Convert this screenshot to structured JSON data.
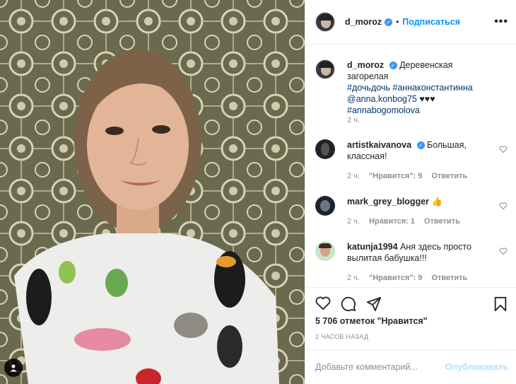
{
  "post": {
    "author": "d_moroz",
    "follow_label": "Подписаться",
    "dot": "•",
    "more": "•••"
  },
  "caption": {
    "author": "d_moroz",
    "text": "Деревенская загорелая",
    "tags_line1": "#дочьдочь #аннаконстантинна",
    "mention": "@anna.konbog75",
    "hearts": "♥♥♥",
    "tags_line2": "#annabogomolova",
    "time": "2 ч."
  },
  "comments": [
    {
      "author": "artistkaivanova",
      "verified": true,
      "text_line1": "Большая,",
      "text_line2": "классная!",
      "time": "2 ч.",
      "likes": "\"Нравится\": 9",
      "reply": "Ответить"
    },
    {
      "author": "mark_grey_blogger",
      "verified": false,
      "text_line1": "👍",
      "text_line2": "",
      "time": "2 ч.",
      "likes": "Нравится: 1",
      "reply": "Ответить"
    },
    {
      "author": "katunja1994",
      "verified": false,
      "text_line1": "Аня здесь просто",
      "text_line2": "вылитая бабушка!!!",
      "time": "2 ч.",
      "likes": "\"Нравится\": 9",
      "reply": "Ответить"
    }
  ],
  "stats": {
    "likes": "5 706 отметок \"Нравится\"",
    "time_ago": "2 ЧАСОВ НАЗАД"
  },
  "composer": {
    "placeholder": "Добавьте комментарий...",
    "publish": "Опубликовать"
  },
  "icons": [
    "heart-icon",
    "comment-icon",
    "share-icon",
    "bookmark-icon",
    "more-icon",
    "verified-icon",
    "user-tag-icon"
  ],
  "colors": {
    "link": "#0095f6",
    "verified": "#3897f0",
    "muted": "#8e8e8e",
    "publish_disabled": "#b2dffc"
  }
}
